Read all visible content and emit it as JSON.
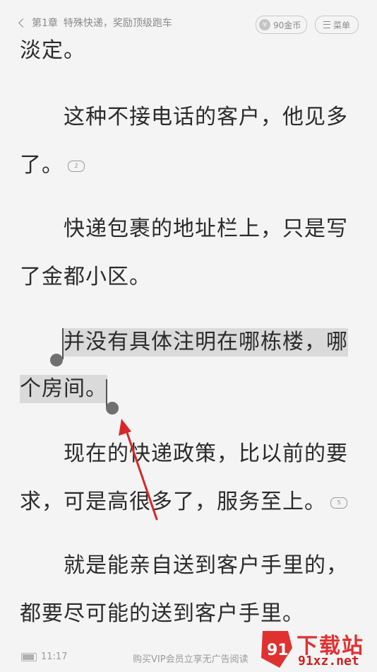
{
  "header": {
    "chapter": "第1章",
    "chapter_title": "特殊快递，奖励顶级跑车",
    "coins": "90金币",
    "coin_symbol": "¥",
    "menu_label": "菜单"
  },
  "content": {
    "lines": [
      "淡定。",
      "这种不接电话的客户，他见多",
      "了。",
      "快递包裹的地址栏上，只是写",
      "了金都小区。",
      "并没有具体注明在哪栋楼，哪",
      "个房间。",
      "现在的快递政策，比以前的要",
      "求，可是高很多了，服务至上。",
      "就是能亲自送到客户手里的，",
      "都要尽可能的送到客户手里。"
    ],
    "comment_counts": [
      "2",
      "5"
    ]
  },
  "footer": {
    "time": "11:17",
    "vip_text": "购买VIP会员立享无广告阅读"
  },
  "watermark": {
    "brand": "下载站",
    "domain": "91xz.net",
    "mark_text": "91"
  },
  "colors": {
    "background": "#f4f4f4",
    "selection": "#dadada",
    "arrow": "#d62828",
    "watermark": "#e03131"
  }
}
